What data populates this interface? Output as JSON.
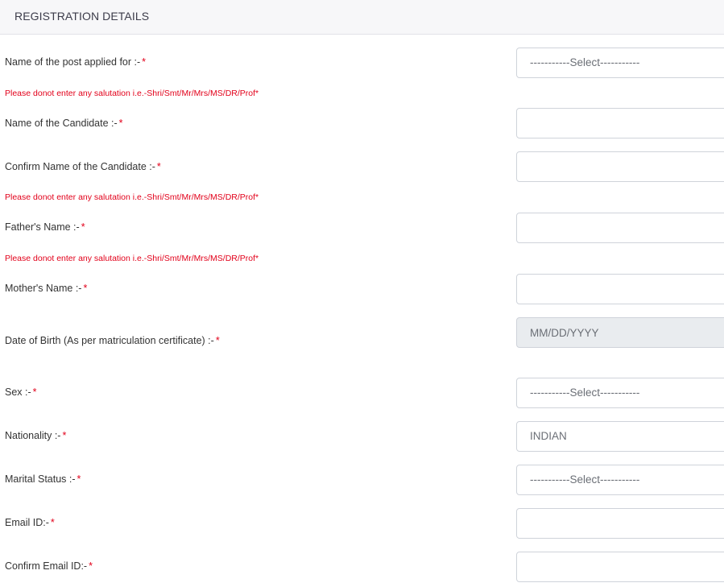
{
  "header": {
    "title": "REGISTRATION DETAILS"
  },
  "required_marker": "*",
  "salutation_note": "Please donot enter any salutation i.e.-Shri/Smt/Mr/Mrs/MS/DR/Prof*",
  "fields": {
    "post": {
      "label": "Name of the post applied for :-",
      "value": "-----------Select-----------"
    },
    "candidate_name": {
      "label": "Name of the Candidate :-",
      "value": ""
    },
    "confirm_candidate_name": {
      "label": "Confirm Name of the Candidate :-",
      "value": ""
    },
    "father_name": {
      "label": "Father's Name :-",
      "value": ""
    },
    "mother_name": {
      "label": "Mother's Name :-",
      "value": ""
    },
    "dob": {
      "label": "Date of Birth (As per matriculation certificate) :-",
      "placeholder": "MM/DD/YYYY"
    },
    "sex": {
      "label": "Sex :-",
      "value": "-----------Select-----------"
    },
    "nationality": {
      "label": "Nationality :-",
      "value": "INDIAN"
    },
    "marital_status": {
      "label": "Marital Status :-",
      "value": "-----------Select-----------"
    },
    "email": {
      "label": "Email ID:-",
      "value": ""
    },
    "confirm_email": {
      "label": "Confirm Email ID:-",
      "value": ""
    }
  }
}
